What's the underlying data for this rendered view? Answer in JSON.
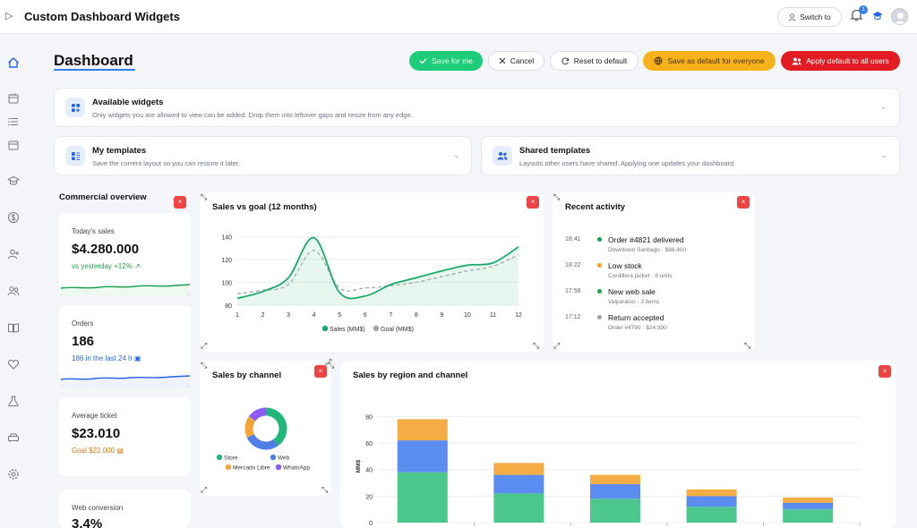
{
  "app": {
    "title": "Custom Dashboard Widgets",
    "switch_label": "Switch to",
    "notifications_count": "1"
  },
  "page": {
    "title": "Dashboard"
  },
  "actions": {
    "save": "Save for me",
    "cancel": "Cancel",
    "reset": "Reset to default",
    "save_everyone": "Save as default for everyone",
    "apply_all": "Apply default to all users"
  },
  "panels": {
    "available": {
      "title": "Available widgets",
      "desc": "Only widgets you are allowed to view can be added. Drop them into leftover gaps and resize from any edge."
    },
    "my_templates": {
      "title": "My templates",
      "desc": "Save the current layout so you can restore it later."
    },
    "shared_templates": {
      "title": "Shared templates",
      "desc": "Layouts other users have shared. Applying one updates your dashboard."
    }
  },
  "commercial": {
    "title": "Commercial overview",
    "kpis": [
      {
        "label": "Today's sales",
        "value": "$4.280.000",
        "note": "vs yesterday +12%",
        "note_color": "#16a34a"
      },
      {
        "label": "Orders",
        "value": "186",
        "note": "186 in the last 24 h",
        "note_color": "#2563eb"
      },
      {
        "label": "Average ticket",
        "value": "$23.010",
        "note": "Goal $22.000",
        "note_color": "#d97706"
      },
      {
        "label": "Web conversion",
        "value": "3,4%",
        "note": "",
        "note_color": "#16a34a"
      }
    ]
  },
  "sales_vs_goal": {
    "title": "Sales vs goal (12 months)"
  },
  "recent_activity": {
    "title": "Recent activity",
    "items": [
      {
        "time": "18:41",
        "title": "Order #4821 delivered",
        "sub": "Downtown Santiago · $86,400",
        "color": "#16a34a"
      },
      {
        "time": "18:22",
        "title": "Low stock",
        "sub": "Cordillera jacket · 8 units",
        "color": "#f59e0b"
      },
      {
        "time": "17:58",
        "title": "New web sale",
        "sub": "Valparaíso · 3 items",
        "color": "#16a34a"
      },
      {
        "time": "17:12",
        "title": "Return accepted",
        "sub": "Order #4790 · $24,990",
        "color": "#9ca3af"
      }
    ]
  },
  "sales_by_channel": {
    "title": "Sales by channel"
  },
  "sales_by_region": {
    "title": "Sales by region and channel"
  },
  "chart_data": [
    {
      "type": "line",
      "x": [
        1,
        2,
        3,
        4,
        5,
        6,
        7,
        8,
        9,
        10,
        11,
        12
      ],
      "series": [
        {
          "name": "Sales (MM$)",
          "values": [
            86,
            92,
            104,
            139,
            91,
            88,
            98,
            104,
            110,
            115,
            117,
            131
          ],
          "color": "#1aab6a"
        },
        {
          "name": "Goal (MM$)",
          "values": [
            90,
            93,
            98,
            128,
            95,
            95,
            97,
            100,
            105,
            110,
            114,
            124
          ],
          "color": "#9aa3ad"
        }
      ],
      "ylim": [
        80,
        145
      ],
      "yticks": [
        80,
        100,
        120,
        140
      ]
    },
    {
      "type": "pie",
      "donut": true,
      "series": [
        {
          "name": "Store",
          "value": 40,
          "color": "#20b77a"
        },
        {
          "name": "Web",
          "value": 28,
          "color": "#4f7fe6"
        },
        {
          "name": "Mercado Libre",
          "value": 17,
          "color": "#f3a53a"
        },
        {
          "name": "WhatsApp",
          "value": 15,
          "color": "#8b5cf6"
        }
      ]
    },
    {
      "type": "bar",
      "stacked": true,
      "ylabel": "MM$",
      "ylim": [
        0,
        85
      ],
      "yticks": [
        0,
        20,
        40,
        60,
        80
      ],
      "categories": [
        "",
        "",
        "",
        "",
        ""
      ],
      "series": [
        {
          "name": "Store",
          "values": [
            38,
            22,
            18,
            12,
            10
          ],
          "color": "#4cc88f"
        },
        {
          "name": "Web",
          "values": [
            24,
            14,
            11,
            8,
            5
          ],
          "color": "#5b8df0"
        },
        {
          "name": "Mercado Libre",
          "values": [
            16,
            9,
            7,
            5,
            4
          ],
          "color": "#f4ad45"
        }
      ]
    }
  ]
}
